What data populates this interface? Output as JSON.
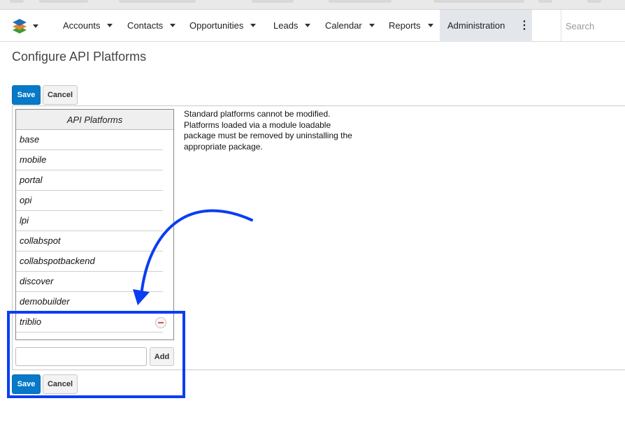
{
  "nav": {
    "items": [
      {
        "label": "Accounts"
      },
      {
        "label": "Contacts"
      },
      {
        "label": "Opportunities"
      },
      {
        "label": "Leads"
      },
      {
        "label": "Calendar"
      },
      {
        "label": "Reports"
      }
    ],
    "active_label": "Administration",
    "more_icon": "⋮",
    "search_placeholder": "Search"
  },
  "page": {
    "title": "Configure API Platforms"
  },
  "buttons": {
    "save_label": "Save",
    "cancel_label": "Cancel",
    "add_label": "Add"
  },
  "platforms": {
    "header": "API Platforms",
    "rows": [
      "base",
      "mobile",
      "portal",
      "opi",
      "lpi",
      "collabspot",
      "collabspotbackend",
      "discover",
      "demobuilder",
      "triblio"
    ],
    "removable": "triblio"
  },
  "info": {
    "lines": [
      "Standard platforms cannot be modified.",
      "Platforms loaded via a module loadable",
      "package must be removed by uninstalling the",
      "appropriate package."
    ]
  },
  "annotation": {
    "color": "#0a3ef2"
  },
  "colors": {
    "primary_button": "#0679c8",
    "active_nav": "#e3e7ec"
  }
}
